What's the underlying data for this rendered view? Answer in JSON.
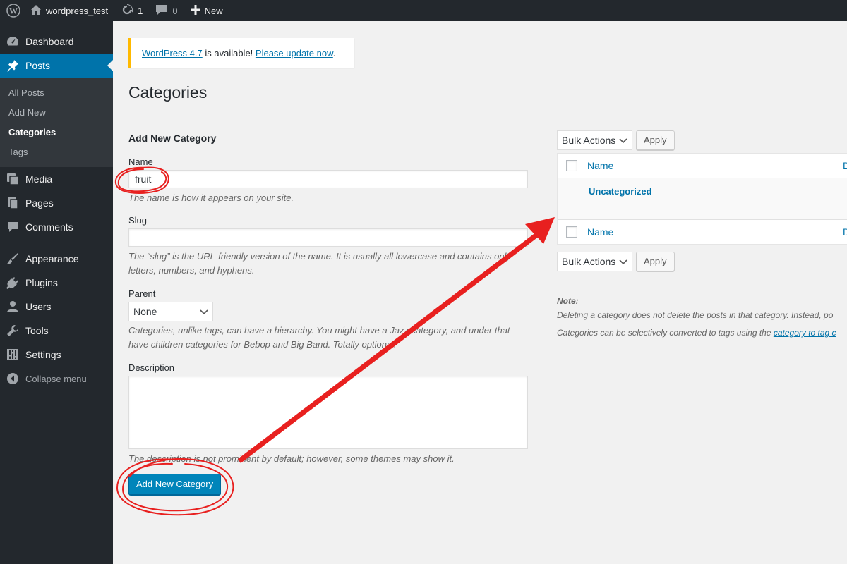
{
  "adminbar": {
    "site_name": "wordpress_test",
    "updates_count": "1",
    "comments_count": "0",
    "new_label": "New"
  },
  "sidebar": {
    "items": [
      {
        "label": "Dashboard",
        "icon": "dashboard-icon"
      },
      {
        "label": "Posts",
        "icon": "pushpin-icon"
      },
      {
        "label": "Media",
        "icon": "media-icon"
      },
      {
        "label": "Pages",
        "icon": "pages-icon"
      },
      {
        "label": "Comments",
        "icon": "comment-icon"
      },
      {
        "label": "Appearance",
        "icon": "paintbrush-icon"
      },
      {
        "label": "Plugins",
        "icon": "plugin-icon"
      },
      {
        "label": "Users",
        "icon": "user-icon"
      },
      {
        "label": "Tools",
        "icon": "wrench-icon"
      },
      {
        "label": "Settings",
        "icon": "settings-icon"
      }
    ],
    "submenu": [
      "All Posts",
      "Add New",
      "Categories",
      "Tags"
    ],
    "collapse_label": "Collapse menu"
  },
  "notice": {
    "link1": "WordPress 4.7",
    "middle": " is available! ",
    "link2": "Please update now",
    "end": "."
  },
  "page_title": "Categories",
  "form": {
    "heading": "Add New Category",
    "name_label": "Name",
    "name_value": "fruit",
    "name_help": "The name is how it appears on your site.",
    "slug_label": "Slug",
    "slug_value": "",
    "slug_help": "The “slug” is the URL-friendly version of the name. It is usually all lowercase and contains only letters, numbers, and hyphens.",
    "parent_label": "Parent",
    "parent_value": "None",
    "parent_help": "Categories, unlike tags, can have a hierarchy. You might have a Jazz category, and under that have children categories for Bebop and Big Band. Totally optional.",
    "description_label": "Description",
    "description_help": "The description is not prominent by default; however, some themes may show it.",
    "submit_label": "Add New Category"
  },
  "list": {
    "bulk_actions": "Bulk Actions",
    "apply": "Apply",
    "col_name": "Name",
    "col_desc_partial": "D",
    "rows": [
      "Uncategorized"
    ],
    "note_title": "Note:",
    "note_line1": "Deleting a category does not delete the posts in that category. Instead, po",
    "note_line2_prefix": "Categories can be selectively converted to tags using the ",
    "note_line2_link": "category to tag c"
  },
  "colors": {
    "accent": "#0073aa",
    "admin_bg": "#23282d",
    "notice_border": "#ffb900",
    "annotation": "#e8201f"
  }
}
